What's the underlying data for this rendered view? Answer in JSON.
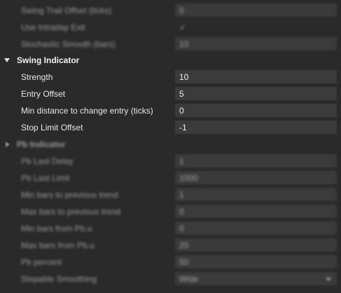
{
  "blurred_top": [
    {
      "label": "Swing Trail Offset (ticks)",
      "value": "0"
    },
    {
      "label": "Use Intraday Exit",
      "value": "✓"
    },
    {
      "label": "Stochastic Smooth (bars)",
      "value": "10"
    }
  ],
  "swing_indicator": {
    "title": "Swing Indicator",
    "properties": [
      {
        "label": "Strength",
        "value": "10"
      },
      {
        "label": "Entry Offset",
        "value": "5"
      },
      {
        "label": "Min distance to change entry (ticks)",
        "value": "0"
      },
      {
        "label": "Stop Limit Offset",
        "value": "-1"
      }
    ]
  },
  "second_category": {
    "title": "Pb Indicator",
    "properties": [
      {
        "label": "Pb Last Delay",
        "value": "1"
      },
      {
        "label": "Pb Last Limit",
        "value": "1000"
      },
      {
        "label": "Min bars to previous trend",
        "value": "1"
      },
      {
        "label": "Max bars to previous trend",
        "value": "0"
      },
      {
        "label": "Min bars from Pb.u",
        "value": "0"
      },
      {
        "label": "Max bars from Pb.u",
        "value": "20"
      },
      {
        "label": "Pb percent",
        "value": "50"
      },
      {
        "label": "Stepable Smoothing",
        "value": "Wide"
      }
    ]
  }
}
